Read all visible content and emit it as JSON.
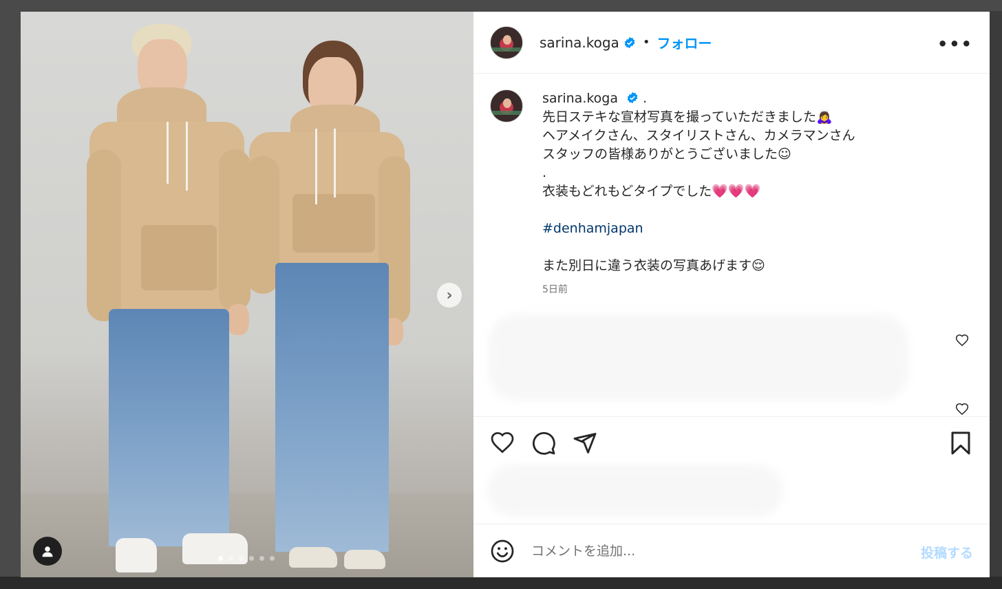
{
  "post": {
    "username": "sarina.koga",
    "follow_label": "フォロー",
    "separator": "•",
    "more_label": "•••"
  },
  "caption": {
    "username": "sarina.koga",
    "lines": [
      " .",
      "先日ステキな宣材写真を撮っていただきました🙇‍♀️",
      "ヘアメイクさん、スタイリストさん、カメラマンさん",
      "スタッフの皆様ありがとうございました☺︎",
      ".",
      "衣装もどれもどタイプでした💗💗💗",
      "#denhamjapan",
      "また別日に違う衣装の写真あげます😌"
    ],
    "time": "5日前"
  },
  "carousel": {
    "next_label": "›",
    "slide_count": 6,
    "active_index": 0
  },
  "comment": {
    "placeholder": "コメントを追加...",
    "post_label": "投稿する"
  },
  "icons": {
    "verified": "verified-badge-icon",
    "like": "heart-icon",
    "comment": "comment-bubble-icon",
    "share": "paper-plane-icon",
    "save": "bookmark-icon",
    "emoji": "emoji-smile-icon",
    "tag": "user-tag-icon"
  },
  "colors": {
    "accent": "#0095f6",
    "hashtag": "#00376b",
    "post_disabled": "#b3dbff"
  }
}
